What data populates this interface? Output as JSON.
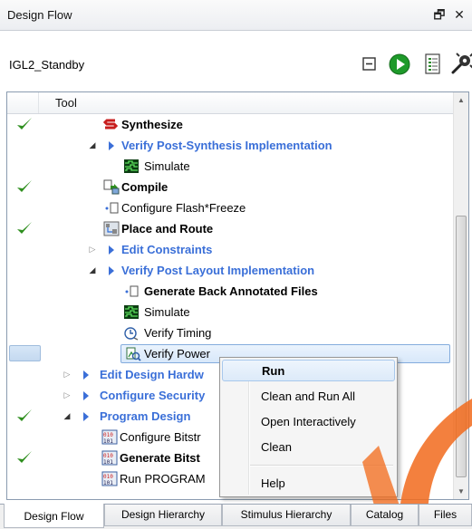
{
  "window": {
    "title": "Design Flow",
    "float_glyph": "🗗",
    "close_glyph": "✕"
  },
  "toolbar": {
    "design_name": "IGL2_Standby",
    "icons": [
      "collapse-all-icon",
      "run-icon",
      "report-icon",
      "options-icon"
    ]
  },
  "tree": {
    "column_header": "Tool",
    "rows": [
      {
        "label": "Synthesize",
        "icon": "synthesize-icon",
        "checked": true,
        "style": "bold",
        "level": 2
      },
      {
        "label": "Verify Post-Synthesis Implementation",
        "icon": "",
        "checked": false,
        "style": "link",
        "level": 1,
        "expander": "open"
      },
      {
        "label": "Simulate",
        "icon": "simulate-icon",
        "checked": false,
        "style": "normal",
        "level": 2
      },
      {
        "label": "Compile",
        "icon": "compile-icon",
        "checked": true,
        "style": "bold",
        "level": 2
      },
      {
        "label": "Configure Flash*Freeze",
        "icon": "configure-icon",
        "checked": false,
        "style": "normal",
        "level": 2
      },
      {
        "label": "Place and Route",
        "icon": "place-route-icon",
        "checked": true,
        "style": "bold",
        "level": 2
      },
      {
        "label": "Edit Constraints",
        "icon": "",
        "checked": false,
        "style": "link",
        "level": 1,
        "expander": "closed"
      },
      {
        "label": "Verify Post Layout Implementation",
        "icon": "",
        "checked": false,
        "style": "link",
        "level": 1,
        "expander": "open"
      },
      {
        "label": "Generate Back Annotated Files",
        "icon": "configure-icon",
        "checked": false,
        "style": "bold",
        "level": 3
      },
      {
        "label": "Simulate",
        "icon": "simulate-icon",
        "checked": false,
        "style": "normal",
        "level": 3
      },
      {
        "label": "Verify Timing",
        "icon": "timing-icon",
        "checked": false,
        "style": "normal",
        "level": 3
      },
      {
        "label": "Verify Power",
        "icon": "power-icon",
        "checked": false,
        "style": "normal",
        "level": 3,
        "selected": true
      },
      {
        "label": "Edit Design Hardw",
        "icon": "",
        "checked": false,
        "style": "link",
        "level": 0,
        "expander": "closed"
      },
      {
        "label": "Configure Security",
        "icon": "",
        "checked": false,
        "style": "link",
        "level": 0,
        "expander": "closed"
      },
      {
        "label": "Program Design",
        "icon": "",
        "checked": true,
        "style": "link",
        "level": 0,
        "expander": "open"
      },
      {
        "label": "Configure Bitstr",
        "icon": "bitstream-icon",
        "checked": false,
        "style": "normal",
        "level": 1
      },
      {
        "label": "Generate Bitst",
        "icon": "bitstream-icon",
        "checked": true,
        "style": "bold",
        "level": 1
      },
      {
        "label": "Run PROGRAM",
        "icon": "bitstream-icon",
        "checked": false,
        "style": "normal",
        "level": 1
      }
    ]
  },
  "context_menu": {
    "items": [
      {
        "label": "Run",
        "bold": true,
        "hover": true
      },
      {
        "label": "Clean and Run All",
        "bold": false,
        "hover": false
      },
      {
        "label": "Open Interactively",
        "bold": false,
        "hover": false
      },
      {
        "label": "Clean",
        "bold": false,
        "hover": false
      },
      {
        "label": "Help",
        "bold": false,
        "hover": false
      }
    ]
  },
  "tabs": [
    {
      "label": "Design Flow",
      "active": true
    },
    {
      "label": "Design Hierarchy",
      "active": false
    },
    {
      "label": "Stimulus Hierarchy",
      "active": false
    },
    {
      "label": "Catalog",
      "active": false
    },
    {
      "label": "Files",
      "active": false
    }
  ],
  "colors": {
    "link_blue": "#3a6fd8",
    "check_green": "#2f8f1f",
    "watermark_orange": "#f26b1d"
  }
}
